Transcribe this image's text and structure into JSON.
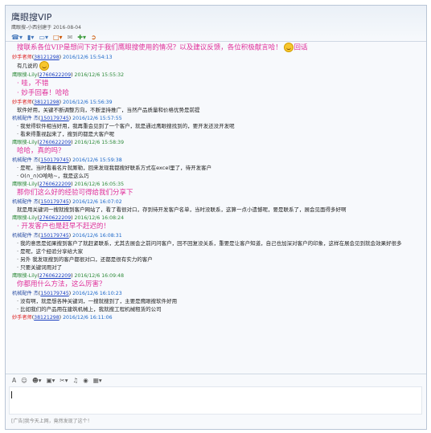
{
  "window": {
    "title": "鹰眼搜VIP",
    "subtitle": "鹰眼搜-小西创建于 2016-08-04"
  },
  "toolbar": {
    "icons": [
      "phone-icon",
      "video-icon",
      "screen-share-icon",
      "folder-icon",
      "mail-icon",
      "add-member-icon",
      "exit-icon"
    ]
  },
  "messages": [
    {
      "type": "big",
      "text": "搜联系各位VIP是想问下对于我们鹰眼搜使用的情况？以及建议反馈，各位积极献言哈！",
      "emoji": true,
      "emoji_text": "回话"
    },
    {
      "sender": "妙手者师",
      "qq": "38121298",
      "time": "2016/12/6 15:54:13",
      "sender_color": "red",
      "time_color": "blue",
      "lines": [
        "有几说的"
      ],
      "emoji_after": true
    },
    {
      "sender": "鹰眼搜-Lily",
      "qq": "2760622209",
      "time": "2016/12/6 15:55:32",
      "sender_color": "green",
      "time_color": "green",
      "big": [
        "· 哇，不错",
        "· 妙手回春！哈哈"
      ]
    },
    {
      "sender": "妙手者师",
      "qq": "38121298",
      "time": "2016/12/6 15:56:39",
      "sender_color": "red",
      "time_color": "blue",
      "lines": [
        "软件好用，关键不断调整方向，不断坚持推广，当然产品质量和价格优势是前提"
      ]
    },
    {
      "sender": "机械配件 杰",
      "qq": "150179745",
      "time": "2016/12/6 15:57:55",
      "sender_color": "blue",
      "time_color": "blue",
      "lines": [
        "· 我觉得软件相当好用，我再重会见到了一个客户，就是通过鹰眼搜找到的，要开发还没开发呢",
        "· 看来得重视起来了，搜到的都是大客户呢"
      ]
    },
    {
      "sender": "鹰眼搜-Lily",
      "qq": "2760622209",
      "time": "2016/12/6 15:58:39",
      "sender_color": "green",
      "time_color": "green",
      "big": [
        "哈哈，真的吗？"
      ]
    },
    {
      "sender": "机械配件 杰",
      "qq": "150179745",
      "time": "2016/12/6 15:59:38",
      "sender_color": "blue",
      "time_color": "blue",
      "lines": [
        "· 是呢，当时看着名片就厮勒，回来发现我都搜好联系方式在excel里了，待开发客户",
        "· O(∩_∩)O哈哈~，我是这么巧"
      ]
    },
    {
      "sender": "鹰眼搜-Lily",
      "qq": "2760622209",
      "time": "2016/12/6 16:05:35",
      "sender_color": "green",
      "time_color": "green",
      "big": [
        "那你们这么好的经验可得给我们分享下"
      ]
    },
    {
      "sender": "机械配件 杰",
      "qq": "150179745",
      "time": "2016/12/6 16:07:02",
      "sender_color": "blue",
      "time_color": "blue",
      "lines": [
        "就是用关键词一搜就搜到客户网站了，看了看很对口，存到待开发客户名单，当时没联系，这算一点小遗憾呢，要是联系了，展会见面得多好啊"
      ]
    },
    {
      "sender": "鹰眼搜-Lily",
      "qq": "2760622209",
      "time": "2016/12/6 16:08:24",
      "sender_color": "green",
      "time_color": "green",
      "big": [
        "· 开发客户也是赶早不赶迟的！"
      ]
    },
    {
      "sender": "机械配件 杰",
      "qq": "150179745",
      "time": "2016/12/6 16:08:31",
      "sender_color": "blue",
      "time_color": "blue",
      "lines": [
        "· 我的意思是如果搜到客户了就赶紧联系，尤其去展会之前问问客户，回不回复没关系，重要是让客户知道，自己也加深对客户的印象，这样在展会见到就会效果好很多",
        "· 是呢，这个经验分享给大家",
        "· 另外 我发现搜到的客户都很对口，还都是很有实力的客户",
        "· 只要关键词用对了"
      ]
    },
    {
      "sender": "鹰眼搜-Lily",
      "qq": "2760622209",
      "time": "2016/12/6 16:09:48",
      "sender_color": "green",
      "time_color": "green",
      "big": [
        "你都用什么方法，这么厉害？"
      ]
    },
    {
      "sender": "机械配件 杰",
      "qq": "150179745",
      "time": "2016/12/6 16:10:23",
      "sender_color": "blue",
      "time_color": "blue",
      "lines": [
        "· 没有啊，就是想各种关键词，一搜就搜到了，主要是鹰眼搜软件好用",
        "· 比如我们的产品用在建筑机械上，我就搜工程机械租赁的公司"
      ]
    },
    {
      "sender": "妙手者师",
      "qq": "38121298",
      "time": "2016/12/6 16:11:06",
      "sender_color": "red",
      "time_color": "blue",
      "lines": []
    }
  ],
  "input_toolbar": {
    "icons": [
      "font-icon",
      "emoji-icon",
      "wink-icon",
      "image-icon",
      "scissors-icon",
      "music-icon",
      "shake-icon",
      "chart-icon"
    ]
  },
  "footer": "[广告]我今天上网，竟然发现了这个！"
}
